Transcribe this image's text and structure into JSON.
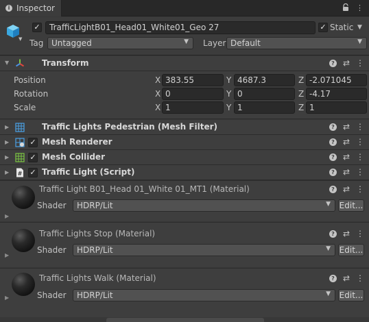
{
  "window": {
    "tab_label": "Inspector"
  },
  "object": {
    "active": true,
    "name": "TrafficLightB01_Head01_White01_Geo 27",
    "static_checked": true,
    "static_label": "Static",
    "tag_label": "Tag",
    "tag_value": "Untagged",
    "layer_label": "Layer",
    "layer_value": "Default"
  },
  "transform": {
    "title": "Transform",
    "rows": [
      {
        "label": "Position",
        "x": "383.55",
        "y": "4687.3",
        "z": "-2.071045"
      },
      {
        "label": "Rotation",
        "x": "0",
        "y": "0",
        "z": "-4.17"
      },
      {
        "label": "Scale",
        "x": "1",
        "y": "1",
        "z": "1"
      }
    ],
    "axes": {
      "x": "X",
      "y": "Y",
      "z": "Z"
    }
  },
  "components": [
    {
      "title": "Traffic Lights Pedestrian (Mesh Filter)",
      "icon": "mesh-filter-icon",
      "has_checkbox": false
    },
    {
      "title": "Mesh Renderer",
      "icon": "mesh-renderer-icon",
      "has_checkbox": true
    },
    {
      "title": "Mesh Collider",
      "icon": "mesh-collider-icon",
      "has_checkbox": true
    },
    {
      "title": "Traffic Light (Script)",
      "icon": "script-icon",
      "has_checkbox": true
    }
  ],
  "materials": [
    {
      "title": "Traffic Light B01_Head 01_White 01_MT1 (Material)",
      "shader_label": "Shader",
      "shader_value": "HDRP/Lit",
      "edit_label": "Edit..."
    },
    {
      "title": "Traffic Lights Stop (Material)",
      "shader_label": "Shader",
      "shader_value": "HDRP/Lit",
      "edit_label": "Edit..."
    },
    {
      "title": "Traffic Lights Walk (Material)",
      "shader_label": "Shader",
      "shader_value": "HDRP/Lit",
      "edit_label": "Edit..."
    }
  ],
  "icons": {
    "info": "info-icon",
    "lock": "lock-icon",
    "menu": "kebab-menu-icon",
    "help": "help-icon",
    "preset": "preset-sliders-icon",
    "gameobject": "cube-icon",
    "transform": "transform-axes-icon"
  },
  "colors": {
    "background": "#383838",
    "header": "#3e3e3e",
    "field": "#2a2a2a",
    "checkbox_tick": "#e6e6e6"
  }
}
